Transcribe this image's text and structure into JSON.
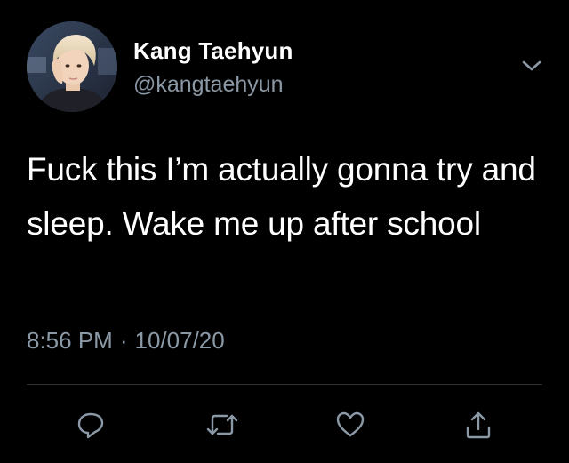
{
  "author": {
    "display_name": "Kang Taehyun",
    "handle": "@kangtaehyun",
    "avatar_icon": "profile-photo"
  },
  "tweet": {
    "text": "Fuck this I’m actually gonna try and sleep. Wake me up after school",
    "time": "8:56 PM",
    "separator": "·",
    "date": "10/07/20"
  },
  "actions": [
    {
      "icon": "reply-icon"
    },
    {
      "icon": "retweet-icon"
    },
    {
      "icon": "like-icon"
    },
    {
      "icon": "share-icon"
    }
  ],
  "colors": {
    "background": "#000000",
    "primary_text": "#ffffff",
    "secondary_text": "#8b98a5",
    "icon": "#8b98a5",
    "divider": "#2f3336"
  }
}
